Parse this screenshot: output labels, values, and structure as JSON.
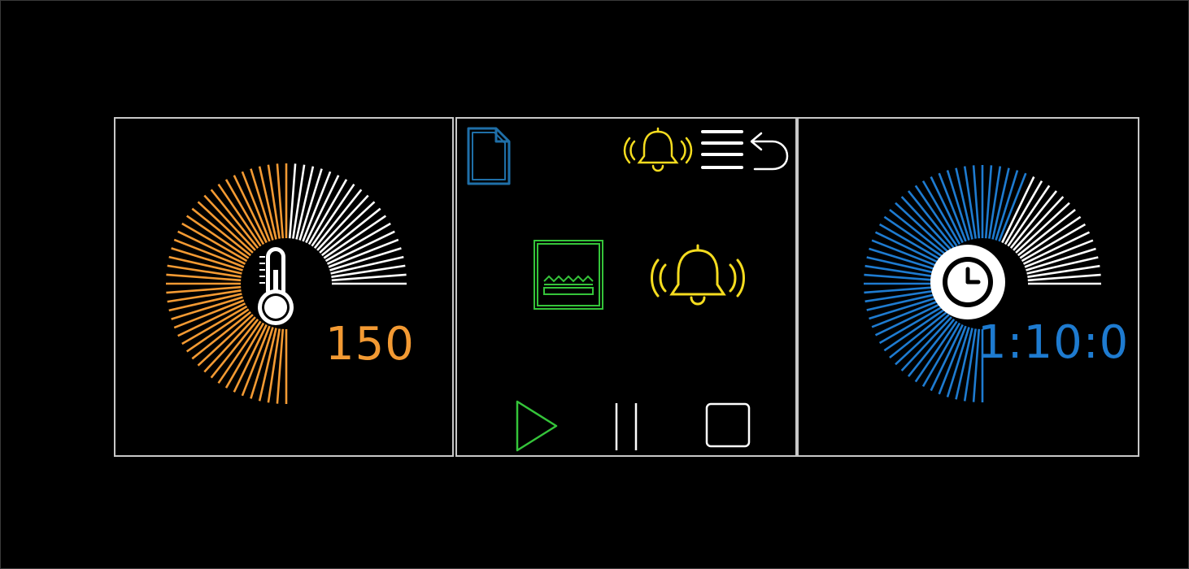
{
  "temperature": {
    "value": "150",
    "level": 0.67,
    "accent": "#f39a33",
    "track": "#ffffff",
    "icon": "thermometer-icon"
  },
  "controls": {
    "program_icon": "document-icon",
    "alarm_icon": "bell-ringing-icon",
    "menu_icon": "menu-icon",
    "back_icon": "undo-arrow-icon",
    "mode_icon": "oven-bottom-heat-icon",
    "alarm_active_icon": "bell-ringing-icon",
    "play_icon": "play-icon",
    "pause_icon": "pause-icon",
    "stop_icon": "stop-icon",
    "colors": {
      "program": "#1f6fa8",
      "alarm": "#f5dc1f",
      "mode": "#35c43a",
      "play": "#35c43a",
      "neutral": "#ffffff"
    }
  },
  "timer": {
    "value": "1:10:0",
    "level": 0.75,
    "accent": "#1e7bd0",
    "track": "#ffffff",
    "icon": "clock-icon"
  }
}
